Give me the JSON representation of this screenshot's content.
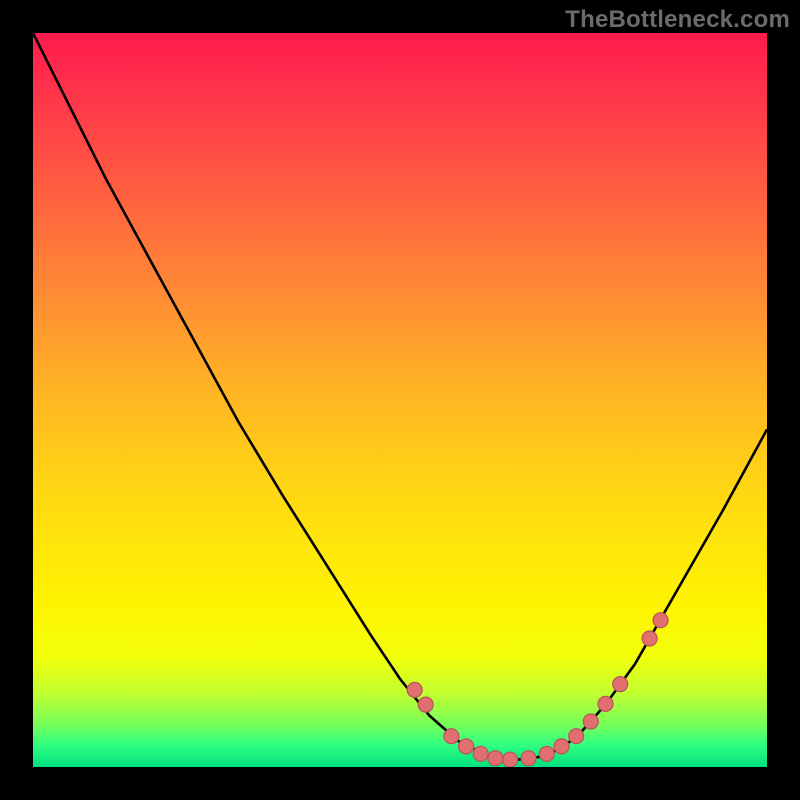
{
  "watermark": "TheBottleneck.com",
  "colors": {
    "frame": "#000000",
    "dot_fill": "#e26f70",
    "dot_stroke": "#b75455",
    "curve": "#000000"
  },
  "chart_data": {
    "type": "line",
    "title": "",
    "xlabel": "",
    "ylabel": "",
    "xlim": [
      0,
      100
    ],
    "ylim": [
      0,
      100
    ],
    "grid": false,
    "legend": false,
    "curve_points": [
      {
        "x": 0.0,
        "y": 100.0
      },
      {
        "x": 5.0,
        "y": 90.0
      },
      {
        "x": 10.0,
        "y": 80.0
      },
      {
        "x": 16.0,
        "y": 69.0
      },
      {
        "x": 22.0,
        "y": 58.0
      },
      {
        "x": 28.0,
        "y": 47.0
      },
      {
        "x": 34.0,
        "y": 37.0
      },
      {
        "x": 40.0,
        "y": 27.5
      },
      {
        "x": 46.0,
        "y": 18.0
      },
      {
        "x": 50.0,
        "y": 12.0
      },
      {
        "x": 54.0,
        "y": 7.0
      },
      {
        "x": 58.0,
        "y": 3.5
      },
      {
        "x": 62.0,
        "y": 1.5
      },
      {
        "x": 66.0,
        "y": 1.0
      },
      {
        "x": 70.0,
        "y": 1.5
      },
      {
        "x": 74.0,
        "y": 4.0
      },
      {
        "x": 78.0,
        "y": 8.5
      },
      {
        "x": 82.0,
        "y": 14.0
      },
      {
        "x": 86.0,
        "y": 21.0
      },
      {
        "x": 90.0,
        "y": 28.0
      },
      {
        "x": 94.0,
        "y": 35.0
      },
      {
        "x": 100.0,
        "y": 46.0
      }
    ],
    "dot_points": [
      {
        "x": 52.0,
        "y": 10.5
      },
      {
        "x": 53.5,
        "y": 8.5
      },
      {
        "x": 57.0,
        "y": 4.2
      },
      {
        "x": 59.0,
        "y": 2.8
      },
      {
        "x": 61.0,
        "y": 1.8
      },
      {
        "x": 63.0,
        "y": 1.2
      },
      {
        "x": 65.0,
        "y": 1.0
      },
      {
        "x": 67.5,
        "y": 1.2
      },
      {
        "x": 70.0,
        "y": 1.8
      },
      {
        "x": 72.0,
        "y": 2.8
      },
      {
        "x": 74.0,
        "y": 4.2
      },
      {
        "x": 76.0,
        "y": 6.2
      },
      {
        "x": 78.0,
        "y": 8.6
      },
      {
        "x": 80.0,
        "y": 11.3
      },
      {
        "x": 84.0,
        "y": 17.5
      },
      {
        "x": 85.5,
        "y": 20.0
      }
    ]
  }
}
